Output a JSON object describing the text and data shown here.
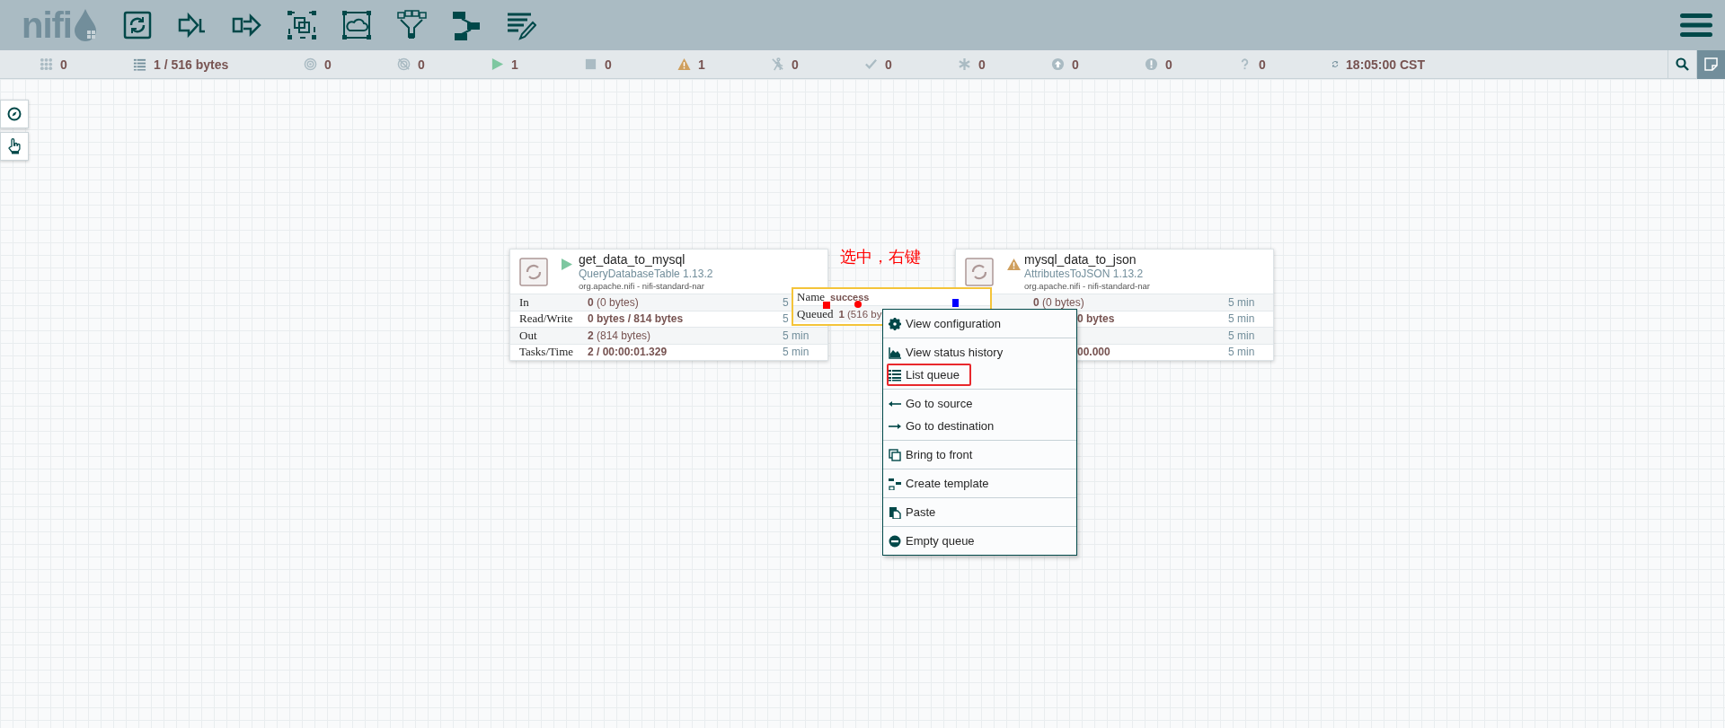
{
  "toolbar": {
    "logo": "nifi"
  },
  "status_bar": {
    "items": [
      {
        "kind": "cluster",
        "text": "0"
      },
      {
        "kind": "queued",
        "text": "1 / 516 bytes"
      },
      {
        "kind": "transmitting",
        "text": "0"
      },
      {
        "kind": "not-transmitting",
        "text": "0"
      },
      {
        "kind": "running",
        "text": "1"
      },
      {
        "kind": "stopped",
        "text": "0"
      },
      {
        "kind": "invalid",
        "text": "1"
      },
      {
        "kind": "disabled",
        "text": "0"
      },
      {
        "kind": "up-to-date",
        "text": "0"
      },
      {
        "kind": "locally-modified",
        "text": "0"
      },
      {
        "kind": "stale",
        "text": "0"
      },
      {
        "kind": "modified-stale",
        "text": "0"
      },
      {
        "kind": "sync-failure",
        "text": "0"
      },
      {
        "kind": "refresh",
        "text": "18:05:00 CST"
      }
    ]
  },
  "annotation": "选中，右键",
  "processors": [
    {
      "name": "get_data_to_mysql",
      "type": "QueryDatabaseTable 1.13.2",
      "bundle": "org.apache.nifi - nifi-standard-nar",
      "kind": "running",
      "stats": [
        {
          "label": "In",
          "kind": "io",
          "value": "**0** (0 bytes)",
          "time": "5"
        },
        {
          "label": "Read/Write",
          "kind": "totals",
          "value": "0 bytes / 814 bytes",
          "time": "5"
        },
        {
          "label": "Out",
          "kind": "io",
          "value": "**2** (814 bytes)",
          "time": "5 min"
        },
        {
          "label": "Tasks/Time",
          "kind": "totals",
          "value": "2 / 00:00:01.329",
          "time": "5 min"
        }
      ]
    },
    {
      "name": "mysql_data_to_json",
      "type": "AttributesToJSON 1.13.2",
      "bundle": "org.apache.nifi - nifi-standard-nar",
      "kind": "invalid",
      "stats": [
        {
          "kind": "io",
          "value": "**0** (0 bytes)",
          "time": "5 min"
        },
        {
          "kind": "totals",
          "value_tail": "0 bytes",
          "time": "5 min"
        },
        {
          "kind": "io",
          "time": "5 min"
        },
        {
          "kind": "totals",
          "value_tail": "00.000",
          "time": "5 min"
        }
      ]
    }
  ],
  "connection": {
    "name_label": "Name",
    "name": "success",
    "queued_label": "Queued",
    "queued": "**1** (516 by"
  },
  "context_menu": {
    "groups": [
      [
        {
          "kind": "gear",
          "label": "View configuration",
          "annotated": false
        }
      ],
      [
        {
          "kind": "area-chart",
          "label": "View status history",
          "annotated": false
        },
        {
          "kind": "list",
          "label": "List queue",
          "annotated": true
        }
      ],
      [
        {
          "kind": "arrow-left",
          "label": "Go to source",
          "annotated": false
        },
        {
          "kind": "arrow-right",
          "label": "Go to destination",
          "annotated": false
        }
      ],
      [
        {
          "kind": "copy",
          "label": "Bring to front",
          "annotated": false
        }
      ],
      [
        {
          "kind": "template",
          "label": "Create template",
          "annotated": false
        }
      ],
      [
        {
          "kind": "paste",
          "label": "Paste",
          "annotated": false
        }
      ],
      [
        {
          "kind": "minus-circle",
          "label": "Empty queue",
          "annotated": false
        }
      ]
    ]
  }
}
